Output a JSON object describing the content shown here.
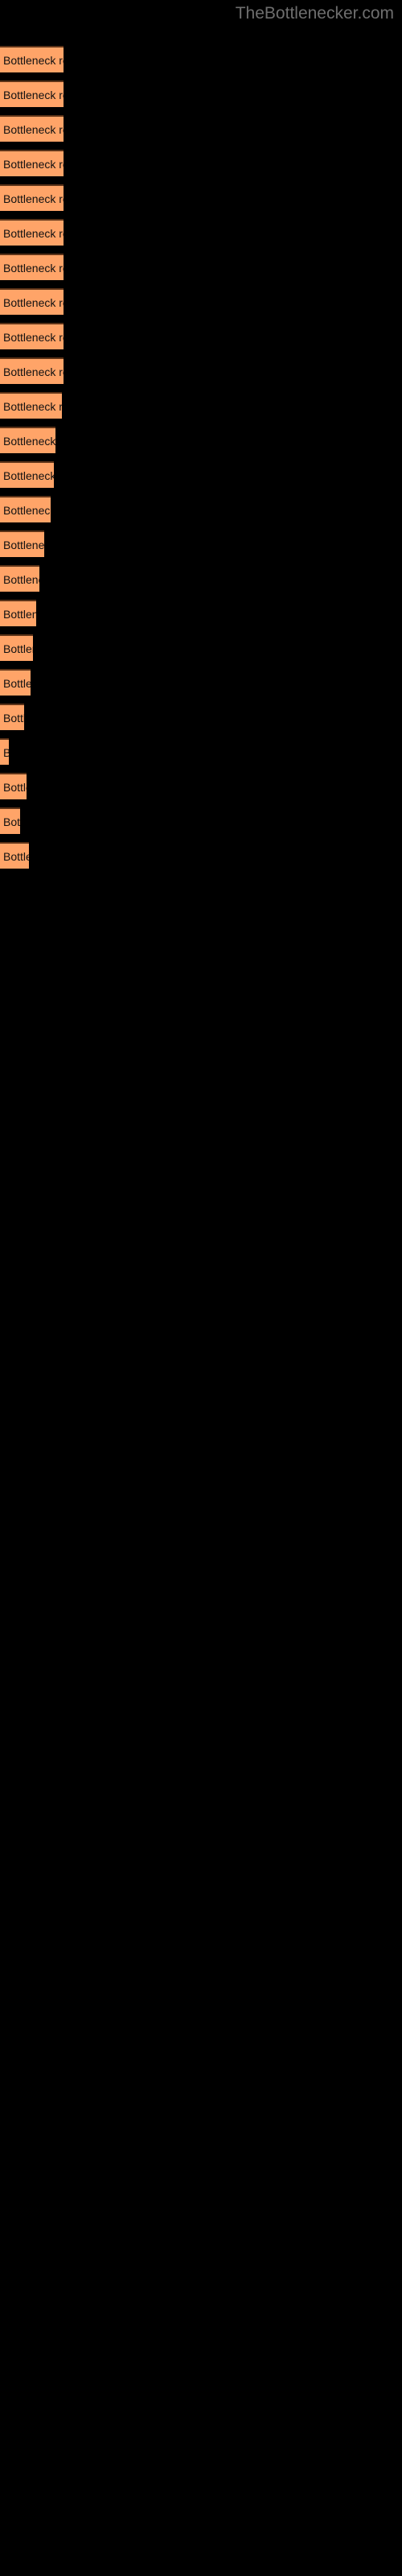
{
  "header": {
    "site_title": "TheBottlenecker.com"
  },
  "colors": {
    "background": "#000000",
    "bar_fill": "#ffa468",
    "bar_border_top": "#5c3318",
    "label_text": "#111111",
    "title_text": "#6e6e6e"
  },
  "chart_data": {
    "type": "bar",
    "orientation": "horizontal",
    "title": "",
    "xlabel": "",
    "ylabel": "",
    "grid": false,
    "legend": null,
    "bar_label_text": "Bottleneck result",
    "categories": [
      "Bottleneck result",
      "Bottleneck result",
      "Bottleneck result",
      "Bottleneck result",
      "Bottleneck result",
      "Bottleneck result",
      "Bottleneck result",
      "Bottleneck result",
      "Bottleneck result",
      "Bottleneck result",
      "Bottleneck result",
      "Bottleneck result",
      "Bottleneck result",
      "Bottleneck result",
      "Bottleneck result",
      "Bottleneck result",
      "Bottleneck result",
      "Bottleneck result",
      "Bottleneck result",
      "Bottleneck result",
      "Bottleneck result",
      "Bottleneck result",
      "Bottleneck result",
      "Bottleneck result"
    ],
    "values": [
      79,
      79,
      79,
      79,
      79,
      79,
      79,
      79,
      79,
      79,
      77,
      69,
      67,
      63,
      55,
      49,
      45,
      41,
      38,
      30,
      11,
      33,
      25,
      36
    ],
    "xlim": [
      0,
      500
    ],
    "bars": [
      {
        "index": 1,
        "y": 57,
        "width": 79,
        "label": "Bottleneck result"
      },
      {
        "index": 2,
        "y": 100,
        "width": 79,
        "label": "Bottleneck result"
      },
      {
        "index": 3,
        "y": 143,
        "width": 79,
        "label": "Bottleneck result"
      },
      {
        "index": 4,
        "y": 186,
        "width": 79,
        "label": "Bottleneck result"
      },
      {
        "index": 5,
        "y": 229,
        "width": 79,
        "label": "Bottleneck result"
      },
      {
        "index": 6,
        "y": 272,
        "width": 79,
        "label": "Bottleneck result"
      },
      {
        "index": 7,
        "y": 315,
        "width": 79,
        "label": "Bottleneck result"
      },
      {
        "index": 8,
        "y": 358,
        "width": 79,
        "label": "Bottleneck result"
      },
      {
        "index": 9,
        "y": 401,
        "width": 79,
        "label": "Bottleneck result"
      },
      {
        "index": 10,
        "y": 444,
        "width": 79,
        "label": "Bottleneck result"
      },
      {
        "index": 11,
        "y": 487,
        "width": 77,
        "label": "Bottleneck result"
      },
      {
        "index": 12,
        "y": 530,
        "width": 69,
        "label": "Bottleneck result"
      },
      {
        "index": 13,
        "y": 573,
        "width": 67,
        "label": "Bottleneck result"
      },
      {
        "index": 14,
        "y": 616,
        "width": 63,
        "label": "Bottleneck result"
      },
      {
        "index": 15,
        "y": 659,
        "width": 55,
        "label": "Bottleneck result"
      },
      {
        "index": 16,
        "y": 702,
        "width": 49,
        "label": "Bottleneck result"
      },
      {
        "index": 17,
        "y": 745,
        "width": 45,
        "label": "Bottleneck result"
      },
      {
        "index": 18,
        "y": 788,
        "width": 41,
        "label": "Bottleneck result"
      },
      {
        "index": 19,
        "y": 831,
        "width": 38,
        "label": "Bottleneck result"
      },
      {
        "index": 20,
        "y": 874,
        "width": 30,
        "label": "Bottleneck result"
      },
      {
        "index": 21,
        "y": 917,
        "width": 11,
        "label": "Bottleneck result"
      },
      {
        "index": 22,
        "y": 960,
        "width": 33,
        "label": "Bottleneck result"
      },
      {
        "index": 23,
        "y": 1003,
        "width": 25,
        "label": "Bottleneck result"
      },
      {
        "index": 24,
        "y": 1046,
        "width": 36,
        "label": "Bottleneck result"
      }
    ]
  }
}
